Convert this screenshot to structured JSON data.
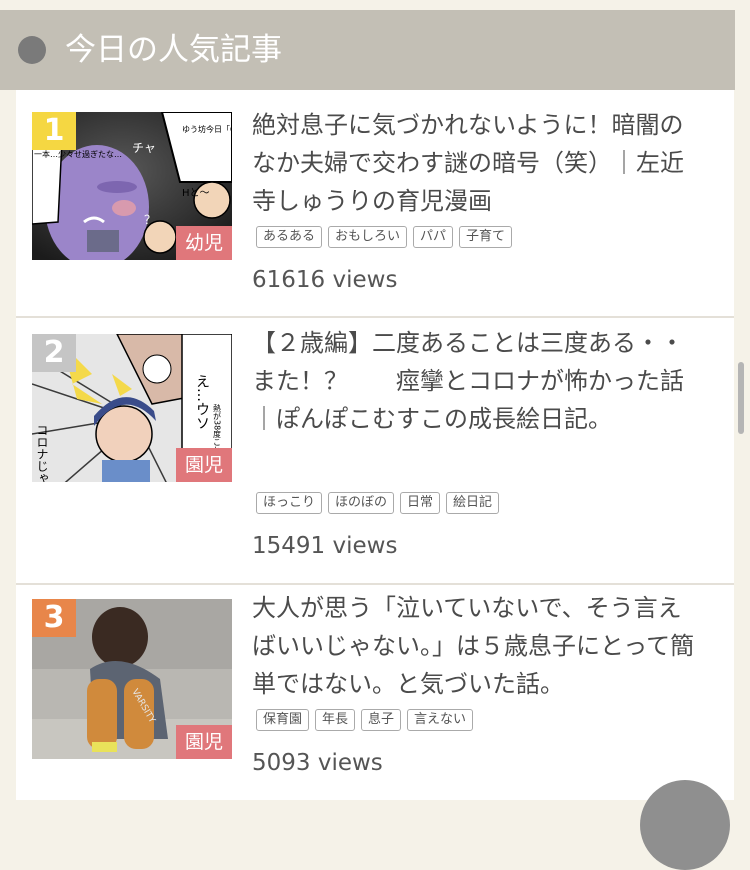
{
  "header": {
    "title": "今日の人気記事"
  },
  "articles": [
    {
      "rank": "1",
      "rank_color": "#f5d742",
      "title": "絶対息子に気づかれないように！暗闇のなか夫婦で交わす謎の暗号（笑）｜左近寺しゅうりの育児漫画",
      "category": "幼児",
      "tags": [
        "あるある",
        "おもしろい",
        "パパ",
        "子育て"
      ],
      "views": "61616 views",
      "thumb_texts": [
        "ゆう坊今日「G」何本イッた？",
        "一本…少々せ過ぎたな…",
        "チャ",
        "Hと～",
        "？"
      ]
    },
    {
      "rank": "2",
      "rank_color": "#c5c5c5",
      "title": "【２歳編】二度あることは三度ある・・また！？　　痙攣とコロナが怖かった話｜ぽんぽこむすこの成長絵日記。",
      "category": "園児",
      "tags": [
        "ほっこり",
        "ほのぼの",
        "日常",
        "絵日記"
      ],
      "views": "15491 views",
      "thumb_texts": [
        "え…ウソ",
        "熱が38度これってもう…",
        "コロナじゃん…!!!"
      ]
    },
    {
      "rank": "3",
      "rank_color": "#e8864a",
      "title": "大人が思う「泣いていないで、そう言えばいいじゃない。」は５歳息子にとって簡単ではない。と気づいた話。",
      "category": "園児",
      "tags": [
        "保育園",
        "年長",
        "息子",
        "言えない"
      ],
      "views": "5093 views",
      "thumb_texts": [
        "VARSITY"
      ]
    }
  ]
}
